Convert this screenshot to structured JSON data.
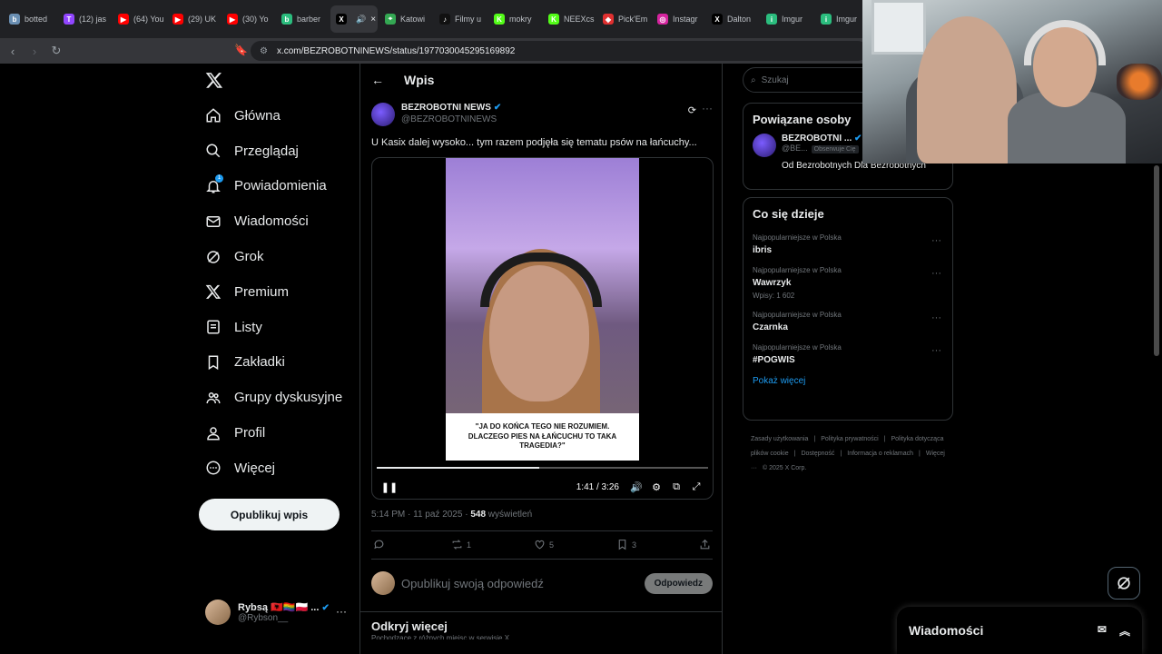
{
  "browser": {
    "tabs": [
      {
        "label": "botted",
        "color": "#6a8fb3",
        "glyph": "b"
      },
      {
        "label": "(12) jas",
        "color": "#9146ff",
        "glyph": "T"
      },
      {
        "label": "(64) You",
        "color": "#ff0000",
        "glyph": "▶"
      },
      {
        "label": "(29) UK",
        "color": "#ff0000",
        "glyph": "▶"
      },
      {
        "label": "(30) Yo",
        "color": "#ff0000",
        "glyph": "▶"
      },
      {
        "label": "barber",
        "color": "#2bbd7e",
        "glyph": "b"
      },
      {
        "label": "",
        "color": "#000000",
        "glyph": "X",
        "active": true
      },
      {
        "label": "Katowi",
        "color": "#34a853",
        "glyph": "⌖"
      },
      {
        "label": "Filmy u",
        "color": "#111111",
        "glyph": "♪"
      },
      {
        "label": "mokry",
        "color": "#53fc18",
        "glyph": "K"
      },
      {
        "label": "NEEXcs",
        "color": "#53fc18",
        "glyph": "K"
      },
      {
        "label": "Pick'Em",
        "color": "#e03030",
        "glyph": "◆"
      },
      {
        "label": "Instagr",
        "color": "#d6249f",
        "glyph": "◎"
      },
      {
        "label": "Dalton",
        "color": "#000000",
        "glyph": "X"
      },
      {
        "label": "Imgur",
        "color": "#2bbd7e",
        "glyph": "i"
      },
      {
        "label": "Imgur",
        "color": "#2bbd7e",
        "glyph": "i"
      }
    ],
    "active_tab_close": "×",
    "url": "x.com/BEZROBOTNINEWS/status/1977030045295169892"
  },
  "nav": {
    "items": [
      {
        "label": "Główna",
        "icon": "home-icon"
      },
      {
        "label": "Przeglądaj",
        "icon": "search-icon"
      },
      {
        "label": "Powiadomienia",
        "icon": "bell-icon",
        "badge": "1"
      },
      {
        "label": "Wiadomości",
        "icon": "mail-icon"
      },
      {
        "label": "Grok",
        "icon": "grok-icon"
      },
      {
        "label": "Premium",
        "icon": "x-logo-icon"
      },
      {
        "label": "Listy",
        "icon": "list-icon"
      },
      {
        "label": "Zakładki",
        "icon": "bookmark-icon"
      },
      {
        "label": "Grupy dyskusyjne",
        "icon": "people-icon"
      },
      {
        "label": "Profil",
        "icon": "person-icon"
      },
      {
        "label": "Więcej",
        "icon": "more-circle-icon"
      }
    ],
    "post_button": "Opublikuj wpis",
    "account": {
      "name": "Rybsą 🇦🇱🏳️‍🌈🇵🇱 ...",
      "handle": "@Rybson__",
      "more": "···"
    }
  },
  "main": {
    "header_title": "Wpis",
    "author_name": "BEZROBOTNI NEWS",
    "author_handle": "@BEZROBOTNINEWS",
    "more": "···",
    "text": "U Kasix dalej wysoko... tym razem podjęła się tematu psów na łańcuchy...",
    "video": {
      "caption": "\"JA DO KOŃCA TEGO NIE ROZUMIEM. DLACZEGO PIES NA ŁAŃCUCHU TO TAKA TRAGEDIA?\"",
      "time": "1:41 / 3:26",
      "progress": 0.49
    },
    "timestamp": "5:14 PM · 11 paź 2025 · ",
    "views_count": "548",
    "views_label": " wyświetleń",
    "actions": {
      "replies": "",
      "reposts": "1",
      "likes": "5",
      "bookmarks": "3"
    },
    "reply_placeholder": "Opublikuj swoją odpowiedź",
    "reply_button": "Odpowiedz",
    "discover_title": "Odkryj więcej",
    "discover_sub": "Pochodzące z różnych miejsc w serwisie X"
  },
  "right": {
    "search_placeholder": "Szukaj",
    "related_title": "Powiązane osoby",
    "related_name": "BEZROBOTNI ...",
    "related_handle": "@BE...",
    "related_follows": "Obserwuje Cię",
    "related_bio": "Od Bezrobotnych Dla Bezrobotnych",
    "trends_title": "Co się dzieje",
    "trends": [
      {
        "context": "Najpopularniejsze w Polska",
        "title": "ibris",
        "count": ""
      },
      {
        "context": "Najpopularniejsze w Polska",
        "title": "Wawrzyk",
        "count": "Wpisy: 1 602"
      },
      {
        "context": "Najpopularniejsze w Polska",
        "title": "Czarnka",
        "count": ""
      },
      {
        "context": "Najpopularniejsze w Polska",
        "title": "#POGWIS",
        "count": ""
      }
    ],
    "show_more": "Pokaż więcej",
    "footer": [
      "Zasady użytkowania",
      "|",
      "Polityka prywatności",
      "|",
      "Polityka dotycząca plików cookie",
      "|",
      "Dostępność",
      "|",
      "Informacja o reklamach",
      "|",
      "Więcej ···",
      "© 2025 X Corp."
    ]
  },
  "dock": {
    "title": "Wiadomości"
  }
}
